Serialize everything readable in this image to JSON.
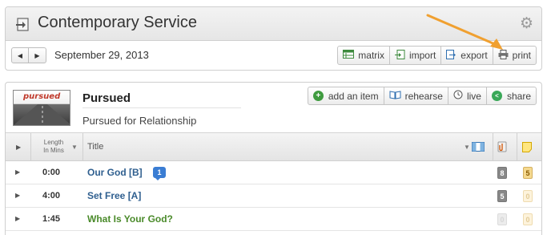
{
  "header": {
    "title": "Contemporary Service",
    "service_icon": "import-document-icon",
    "settings_icon": "gear-icon"
  },
  "date_bar": {
    "prev_icon": "triangle-left-icon",
    "next_icon": "triangle-right-icon",
    "date": "September 29, 2013",
    "tools": [
      {
        "label": "matrix",
        "icon": "matrix-icon"
      },
      {
        "label": "import",
        "icon": "import-icon"
      },
      {
        "label": "export",
        "icon": "export-icon"
      },
      {
        "label": "print",
        "icon": "printer-icon"
      }
    ]
  },
  "annotation": {
    "type": "arrow",
    "color": "#f0a030",
    "points_to": "print"
  },
  "plan": {
    "thumbnail_text": "pursued",
    "title": "Pursued",
    "subtitle": "Pursued for Relationship",
    "actions": [
      {
        "label": "add an item",
        "icon": "plus-circle-icon",
        "color": "#3f9b3f"
      },
      {
        "label": "rehearse",
        "icon": "book-icon",
        "color": "#2f6fb0"
      },
      {
        "label": "live",
        "icon": "clock-icon",
        "color": "#666666"
      },
      {
        "label": "share",
        "icon": "share-icon",
        "color": "#3aa858"
      }
    ]
  },
  "table": {
    "columns": {
      "length_line1": "Length",
      "length_line2": "In Mins",
      "title": "Title"
    },
    "rows": [
      {
        "length": "0:00",
        "title": "Our God [B]",
        "title_color": "#2f5f8f",
        "note_count": "1",
        "count_a": "8",
        "count_b": "5"
      },
      {
        "length": "4:00",
        "title": "Set Free [A]",
        "title_color": "#2f5f8f",
        "note_count": "",
        "count_a": "5",
        "count_b": "0"
      },
      {
        "length": "1:45",
        "title": "What Is Your God?",
        "title_color": "#4a8a2a",
        "note_count": "",
        "count_a": "0",
        "count_b": "0"
      }
    ]
  },
  "colors": {
    "arrow": "#f0a030",
    "song_title": "#2f5f8f",
    "item_title": "#4a8a2a",
    "note_badge": "#3a7dd3"
  }
}
